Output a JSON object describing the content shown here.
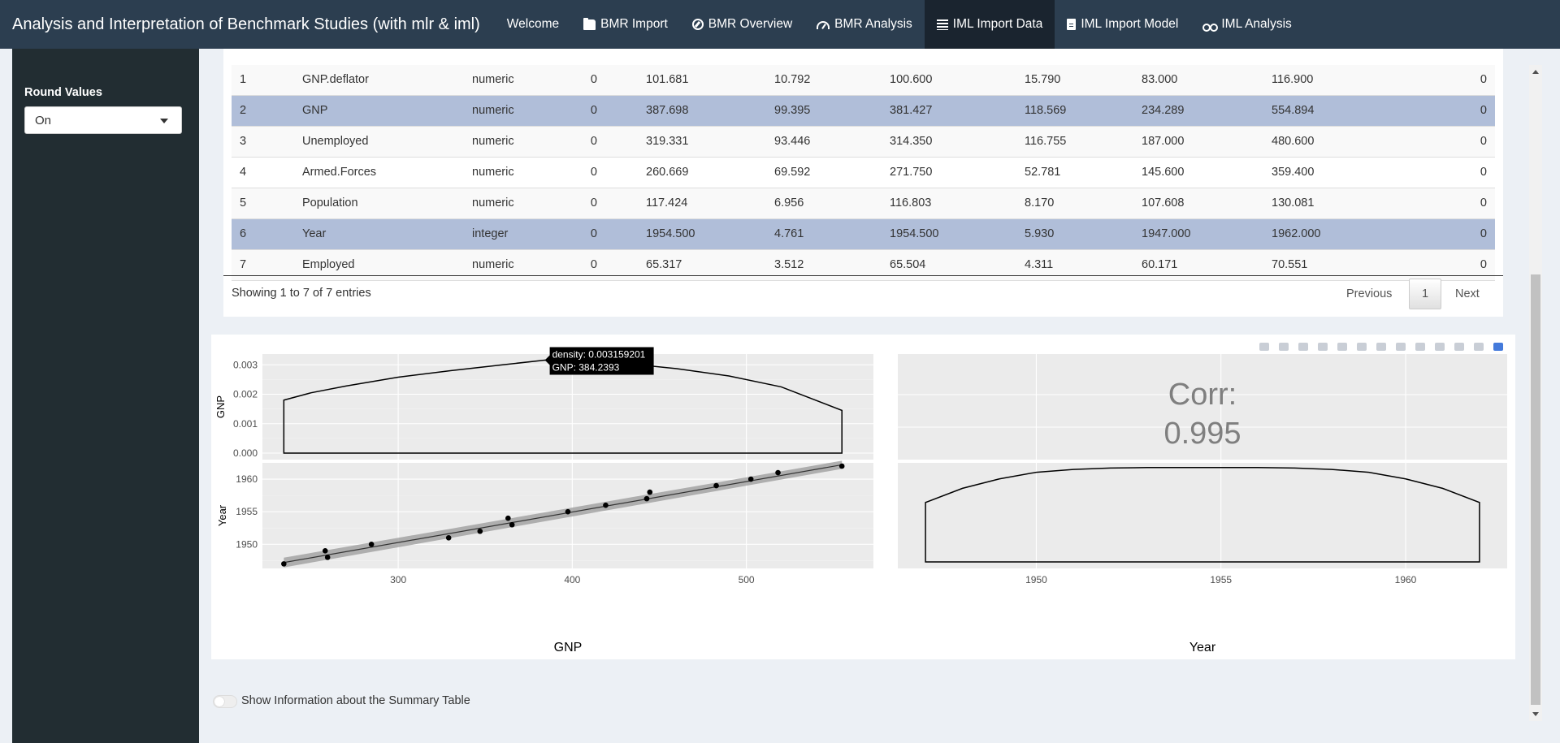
{
  "navbar": {
    "brand": "Analysis and Interpretation of Benchmark Studies (with mlr & iml)",
    "tabs": [
      {
        "label": "Welcome",
        "icon": ""
      },
      {
        "label": "BMR Import",
        "icon": "folder-open-icon"
      },
      {
        "label": "BMR Overview",
        "icon": "compass-icon"
      },
      {
        "label": "BMR Analysis",
        "icon": "tachometer-icon"
      },
      {
        "label": "IML Import Data",
        "icon": "list-icon"
      },
      {
        "label": "IML Import Model",
        "icon": "file-icon"
      },
      {
        "label": "IML Analysis",
        "icon": "glasses-icon"
      }
    ],
    "active_tab": "IML Import Data",
    "bg_color": "#2c3e50",
    "active_color": "#1a242f"
  },
  "sidebar": {
    "round_label": "Round Values",
    "round_value": "On"
  },
  "table": {
    "rows": [
      [
        "1",
        "GNP.deflator",
        "numeric",
        "0",
        "101.681",
        "10.792",
        "100.600",
        "15.790",
        "83.000",
        "116.900",
        "0"
      ],
      [
        "2",
        "GNP",
        "numeric",
        "0",
        "387.698",
        "99.395",
        "381.427",
        "118.569",
        "234.289",
        "554.894",
        "0"
      ],
      [
        "3",
        "Unemployed",
        "numeric",
        "0",
        "319.331",
        "93.446",
        "314.350",
        "116.755",
        "187.000",
        "480.600",
        "0"
      ],
      [
        "4",
        "Armed.Forces",
        "numeric",
        "0",
        "260.669",
        "69.592",
        "271.750",
        "52.781",
        "145.600",
        "359.400",
        "0"
      ],
      [
        "5",
        "Population",
        "numeric",
        "0",
        "117.424",
        "6.956",
        "116.803",
        "8.170",
        "107.608",
        "130.081",
        "0"
      ],
      [
        "6",
        "Year",
        "integer",
        "0",
        "1954.500",
        "4.761",
        "1954.500",
        "5.930",
        "1947.000",
        "1962.000",
        "0"
      ],
      [
        "7",
        "Employed",
        "numeric",
        "0",
        "65.317",
        "3.512",
        "65.504",
        "4.311",
        "60.171",
        "70.551",
        "0"
      ]
    ],
    "selected_rows": [
      2,
      6
    ],
    "selected_color": "#b0bed9",
    "info": "Showing 1 to 7 of 7 entries",
    "prev_label": "Previous",
    "page": "1",
    "next_label": "Next"
  },
  "plot": {
    "tooltip": {
      "line1": "density: 0.003159201",
      "line2": "GNP: 384.2393"
    },
    "corr_label": "Corr:",
    "corr_value": "0.995",
    "modebar_icons": [
      "camera-icon",
      "zoom-icon",
      "pan-icon",
      "box-select-icon",
      "lasso-icon",
      "zoom-in-icon",
      "zoom-out-icon",
      "autoscale-icon",
      "reset-axes-icon",
      "spike-lines-icon",
      "hover-closest-icon",
      "hover-compare-icon",
      "plotly-logo-icon"
    ]
  },
  "chart_data": [
    {
      "type": "area",
      "panel": "GNP density",
      "ylabel": "GNP",
      "x_range": [
        234.289,
        554.894
      ],
      "x": [
        234.289,
        250,
        270,
        300,
        330,
        360,
        384.2393,
        400,
        430,
        460,
        490,
        520,
        554.894
      ],
      "density": [
        0.0018,
        0.00205,
        0.00228,
        0.00258,
        0.0028,
        0.003,
        0.003159201,
        0.00314,
        0.00305,
        0.00287,
        0.00262,
        0.00225,
        0.00145
      ],
      "ylim": [
        0,
        0.0032
      ],
      "yticks": [
        "0.000",
        "0.001",
        "0.002",
        "0.003"
      ]
    },
    {
      "type": "scatter",
      "panel": "GNP vs Year",
      "xlabel": "GNP",
      "ylabel": "Year",
      "xlim": [
        222,
        573
      ],
      "ylim": [
        1946.3,
        1962.5
      ],
      "xticks": [
        "300",
        "400",
        "500"
      ],
      "yticks": [
        "1950",
        "1955",
        "1960"
      ],
      "x": [
        234.289,
        259.426,
        258.054,
        284.599,
        328.975,
        346.999,
        365.385,
        363.112,
        397.469,
        419.18,
        442.769,
        444.546,
        482.704,
        502.601,
        518.173,
        554.894
      ],
      "y": [
        1947,
        1948,
        1949,
        1950,
        1951,
        1952,
        1953,
        1954,
        1955,
        1956,
        1957,
        1958,
        1959,
        1960,
        1961,
        1962
      ],
      "fit": {
        "x": [
          234.289,
          554.894
        ],
        "y": [
          1947.2,
          1962.2
        ]
      }
    },
    {
      "type": "area",
      "panel": "Year density",
      "xlabel": "Year",
      "xlim": [
        1946.25,
        1962.75
      ],
      "xticks": [
        "1950",
        "1955",
        "1960"
      ],
      "x": [
        1947,
        1948,
        1949,
        1950,
        1951,
        1952,
        1953,
        1954,
        1955,
        1956,
        1957,
        1958,
        1959,
        1960,
        1961,
        1962
      ],
      "density": [
        0.63,
        0.78,
        0.88,
        0.95,
        0.98,
        0.995,
        1.0,
        1.0,
        1.0,
        1.0,
        0.995,
        0.98,
        0.95,
        0.88,
        0.78,
        0.63
      ],
      "ylim": [
        0,
        1.05
      ]
    },
    {
      "type": "table",
      "panel": "correlation",
      "label": "Corr:",
      "value": 0.995
    }
  ],
  "footer": {
    "toggle_label": "Show Information about the Summary Table"
  }
}
